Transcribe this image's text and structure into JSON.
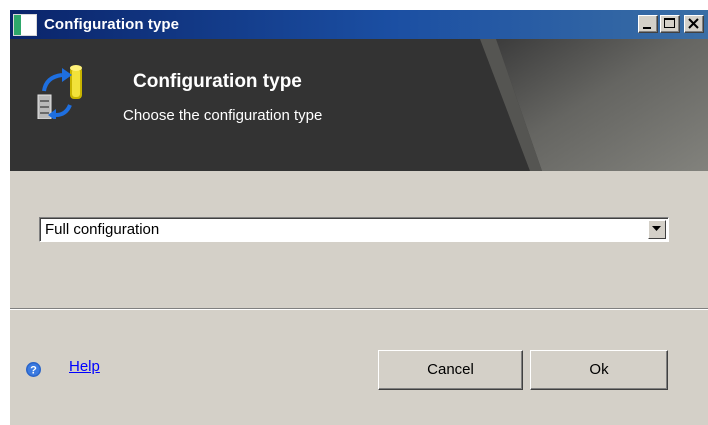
{
  "window": {
    "title": "Configuration type"
  },
  "header": {
    "title": "Configuration type",
    "subtitle": "Choose the configuration type",
    "icon": "database-sync-icon"
  },
  "config_type_select": {
    "selected": "Full configuration"
  },
  "footer": {
    "help_label": "Help",
    "cancel_label": "Cancel",
    "ok_label": "Ok"
  },
  "colors": {
    "titlebar": "#0a246a",
    "header_band": "#333333",
    "dialog_face": "#d4d0c8",
    "link": "#0000ff"
  }
}
